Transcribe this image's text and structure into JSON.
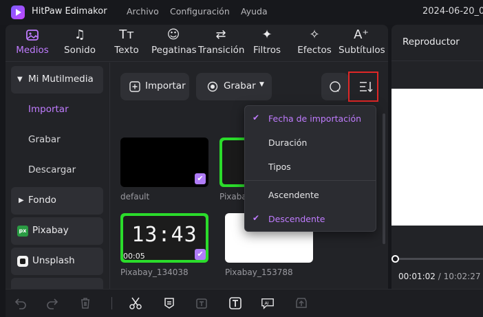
{
  "app": {
    "name": "HitPaw Edimakor",
    "menus": [
      "Archivo",
      "Configuración",
      "Ayuda"
    ],
    "date": "2024-06-20_0"
  },
  "tabs": [
    {
      "label": "Medios",
      "icon": "media-icon",
      "active": true
    },
    {
      "label": "Sonido",
      "icon": "music-note-icon"
    },
    {
      "label": "Texto",
      "icon": "text-icon"
    },
    {
      "label": "Pegatinas",
      "icon": "sticker-icon"
    },
    {
      "label": "Transición",
      "icon": "transition-icon"
    },
    {
      "label": "Filtros",
      "icon": "sparkle-icon"
    },
    {
      "label": "Efectos",
      "icon": "effects-icon"
    },
    {
      "label": "Subtítulos",
      "icon": "subtitle-icon"
    }
  ],
  "sidebar": {
    "media_group": "Mi Mutilmedia",
    "items": [
      "Importar",
      "Grabar",
      "Descargar"
    ],
    "fondo": "Fondo",
    "pixabay": "Pixabay",
    "pixabay_badge": "px",
    "unsplash": "Unsplash"
  },
  "toolbar_top": {
    "import_label": "Importar",
    "record_label": "Grabar"
  },
  "thumbnails": [
    {
      "label": "default",
      "checked": true,
      "style": "black"
    },
    {
      "label": "Pixaba",
      "checked": false,
      "style": "clock"
    },
    {
      "label": "Pixabay_134038",
      "checked": true,
      "style": "clock",
      "duration": "00:05",
      "clock_text": "13:43"
    },
    {
      "label": "Pixabay_153788",
      "checked": false,
      "style": "white"
    },
    {
      "label": "",
      "checked": false,
      "style": "white"
    }
  ],
  "sort_menu": {
    "items": [
      {
        "label": "Fecha de importación",
        "selected": true
      },
      {
        "label": "Duración",
        "selected": false
      },
      {
        "label": "Tipos",
        "selected": false
      },
      {
        "label": "Ascendente",
        "selected": false
      },
      {
        "label": "Descendente",
        "selected": true
      }
    ],
    "check_glyph": "✔"
  },
  "player": {
    "title": "Reproductor",
    "current_time": "00:01:02",
    "separator": " / ",
    "total_time": "10:02:27",
    "progress_fraction": 0
  },
  "colors": {
    "accent": "#c07cff",
    "highlight_box": "#e02727",
    "thumb_green_border": "#2bdc2b"
  }
}
